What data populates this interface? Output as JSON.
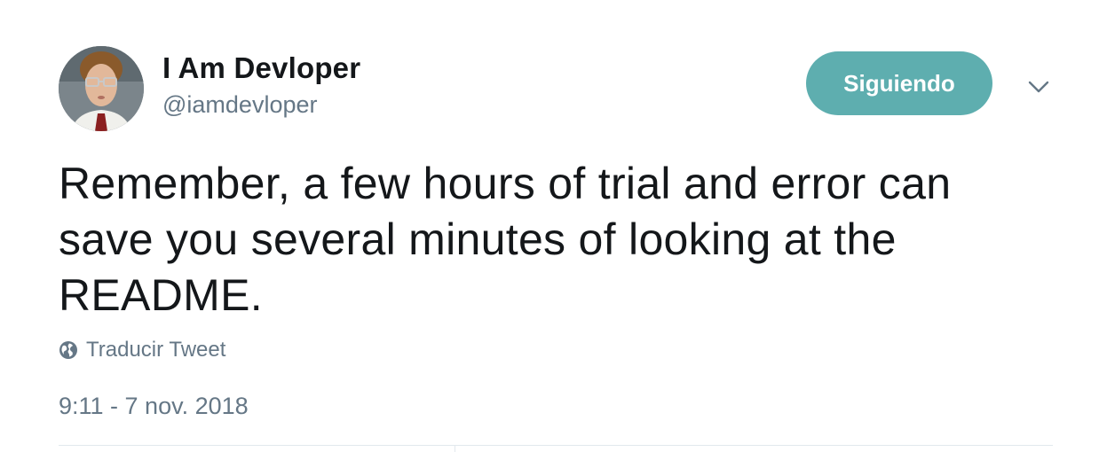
{
  "tweet": {
    "author": {
      "display_name": "I Am Devloper",
      "handle": "@iamdevloper"
    },
    "follow_button_label": "Siguiendo",
    "text": "Remember, a few hours of trial and error can save you several minutes of looking at the README.",
    "translate_label": "Traducir Tweet",
    "timestamp": "9:11 - 7 nov. 2018"
  },
  "icons": {
    "globe": "globe-icon",
    "chevron": "chevron-down-icon"
  },
  "colors": {
    "follow_button": "#5eaeaf",
    "secondary_text": "#657786",
    "primary_text": "#14171a"
  }
}
